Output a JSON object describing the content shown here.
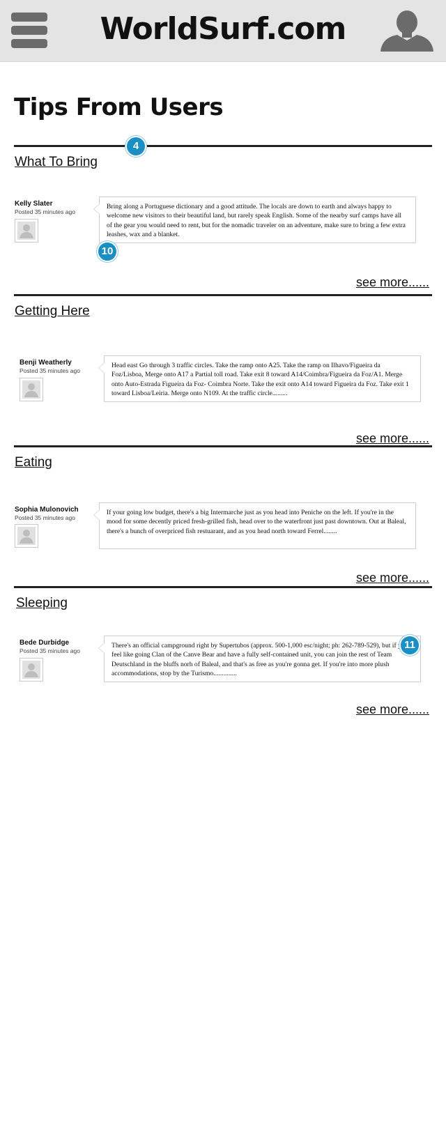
{
  "header": {
    "site_title": "WorldSurf.com",
    "menu_icon": "hamburger-menu-icon",
    "avatar_icon": "user-silhouette-icon"
  },
  "page": {
    "title": "Tips From Users"
  },
  "annotations": {
    "badge_a": "4",
    "badge_b": "10",
    "badge_c": "11"
  },
  "sections": [
    {
      "title": "What To Bring",
      "tip": {
        "author": "Kelly Slater",
        "posted": "Posted 35 minutes ago",
        "text": "Bring along a Portuguese dictionary and a good attitude.  The locals are down to earth and always happy to welcome new visitors to their beautiful land, but rarely speak English.  Some of the nearby surf camps have all of the gear you would need to rent, but for the nomadic traveler on an adventure, make sure to bring a few extra leashes, wax and a blanket."
      },
      "see_more": "see more......"
    },
    {
      "title": "Getting Here",
      "tip": {
        "author": "Benji Weatherly",
        "posted": "Posted 35 minutes ago",
        "text": "Head east Go through 3 traffic circles.  Take the ramp onto A25.  Take the ramp on Ilhavo/Figueira da Foz/Lisboa, Merge onto A17 a Partial toll road.  Take exit 8 toward A14/Coimbra/Figueira da Foz/A1.  Merge onto Auto-Estrada Figueira da Foz- Coimbra Norte.  Take the exit onto A14 toward Figueira da Foz.  Take exit 1 toward Lisboa/Leiria.  Merge onto N109.  At the traffic circle........."
      },
      "see_more": "see more......"
    },
    {
      "title": "Eating",
      "tip": {
        "author": "Sophia Mulonovich",
        "posted": "Posted 35 minutes ago",
        "text": "If your going low budget, there's a big Intermarche just as you head into Peniche on the left.  If you're in the mood for some decently priced fresh-grilled fish, head over to the waterfront just past downtown.  Out at Baleal, there's a bunch of overpriced fish restuarant, and as you head north toward Ferrel........"
      },
      "see_more": "see more......"
    },
    {
      "title": "Sleeping",
      "tip": {
        "author": "Bede Durbidge",
        "posted": "Posted 35 minutes ago",
        "text": "There's an official campground right by Supertubos (approx. 500-1,000 esc/night; ph: 262-789-529), but if you feel like going Clan of the Canve Bear and have a fully self-contained unit, you can join the rest of Team Deutschland in the bluffs norh of Baleal, and that's as free as you're gonna get.  If you're into more plush accommodations, stop by the Turismo.............."
      },
      "see_more": "see more......"
    }
  ]
}
